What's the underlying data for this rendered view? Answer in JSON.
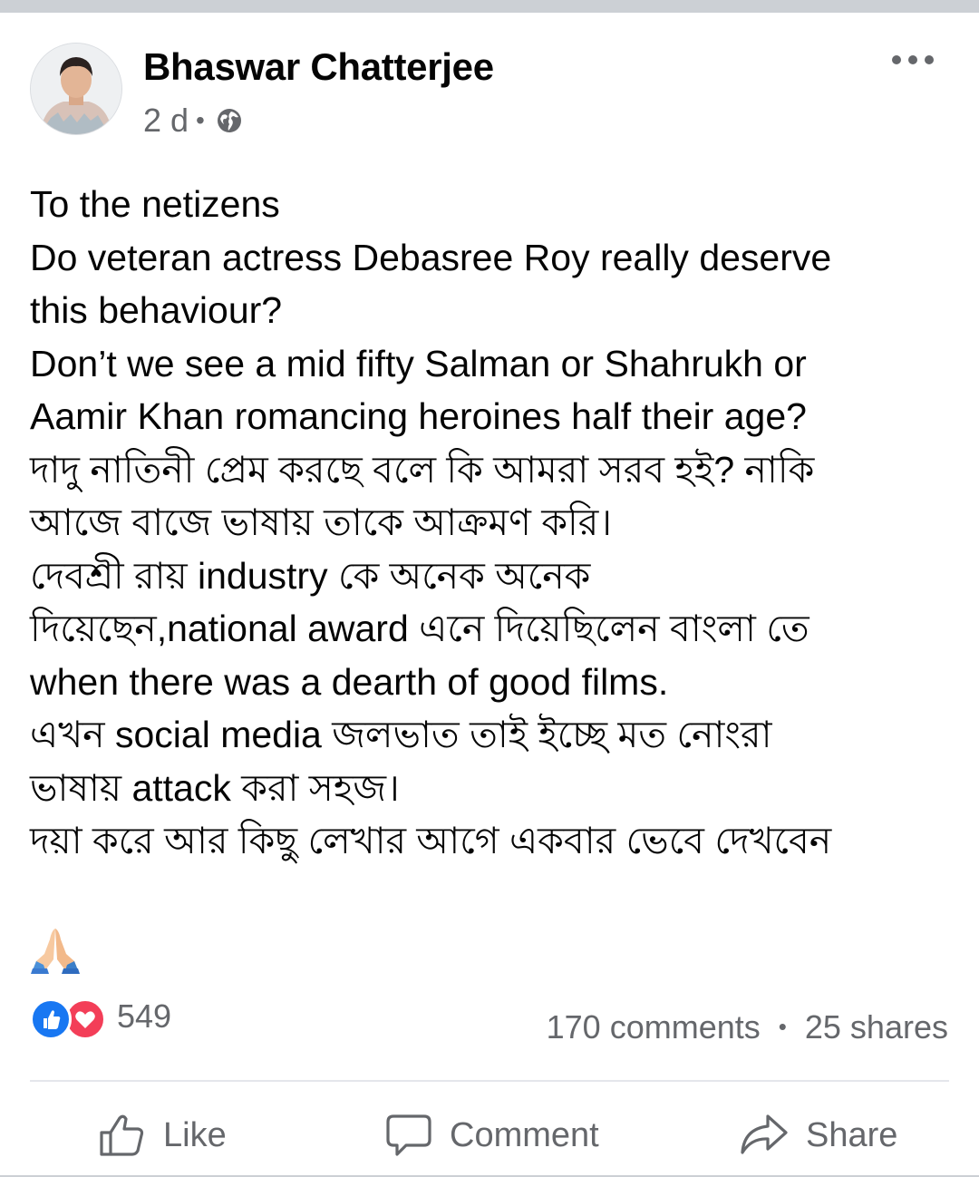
{
  "post": {
    "author": "Bhaswar Chatterjee",
    "time": "2 d",
    "separator": "•",
    "privacy_icon": "globe-icon",
    "menu_icon": "more-options-icon",
    "lines": [
      "To the netizens",
      "Do veteran actress Debasree Roy really deserve",
      "this behaviour?",
      "Don’t we see a mid fifty Salman or Shahrukh or",
      "Aamir Khan romancing heroines half their age?",
      "দাদু নাতিনী প্রেম করছে বলে কি আমরা সরব হই? নাকি",
      "আজে বাজে ভাষায় তাকে আক্রমণ করি।",
      "দেবশ্রী রায় industry কে অনেক অনেক",
      "দিয়েছেন,national award এনে দিয়েছিলেন বাংলা তে",
      "when there was a dearth of good films.",
      "এখন social media জলভাত তাই ইচ্ছে মত নোংরা",
      "ভাষায় attack করা সহজ।",
      "দয়া করে আর কিছু লেখার আগে একবার ভেবে দেখবেন"
    ],
    "emoji": "folded-hands-emoji"
  },
  "stats": {
    "reaction_icons": [
      "like-reaction-icon",
      "love-reaction-icon"
    ],
    "reaction_count": "549",
    "comments": "170 comments",
    "dot": "•",
    "shares": "25 shares"
  },
  "actions": {
    "like": "Like",
    "comment": "Comment",
    "share": "Share"
  },
  "colors": {
    "facebook_blue": "#1877f2",
    "love_red": "#f33e58",
    "secondary_text": "#65676b",
    "primary_text": "#050505",
    "background_band": "#ccd0d5"
  }
}
